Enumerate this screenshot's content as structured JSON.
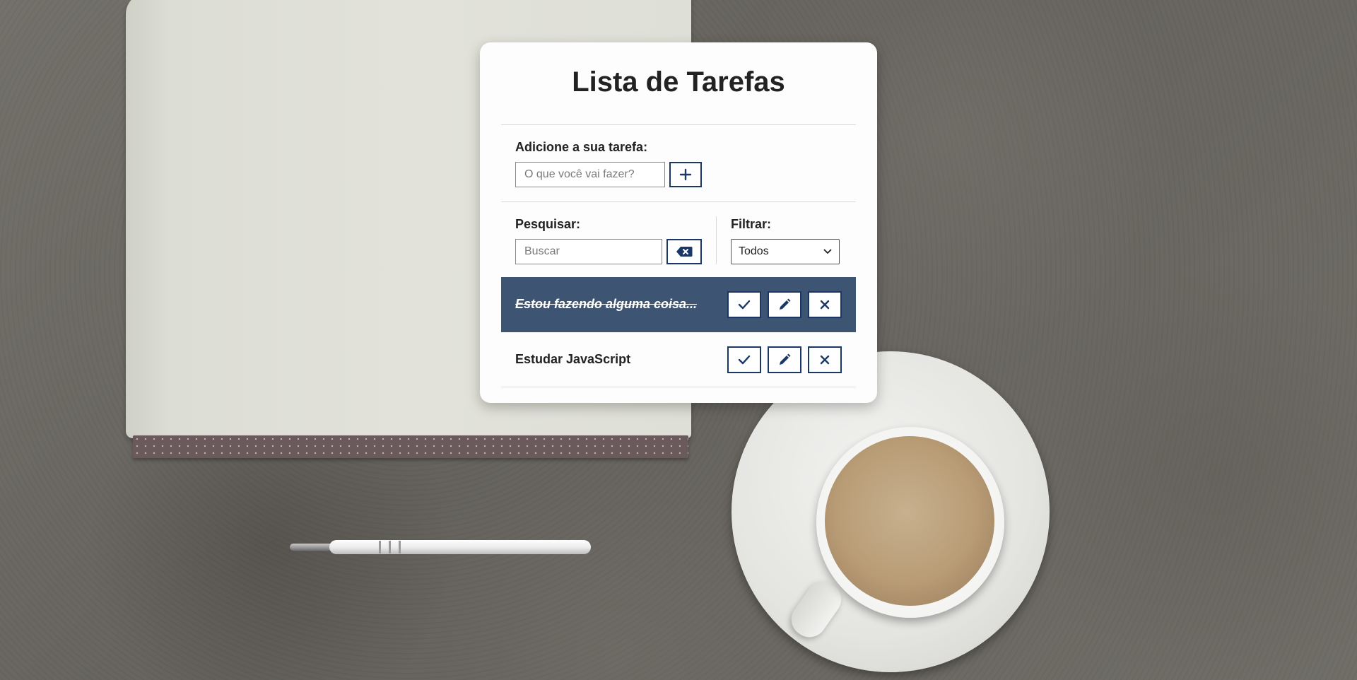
{
  "app": {
    "title": "Lista de Tarefas"
  },
  "add_section": {
    "label": "Adicione a sua tarefa:",
    "placeholder": "O que você vai fazer?",
    "value": "",
    "button_icon": "plus-icon"
  },
  "search_section": {
    "label": "Pesquisar:",
    "placeholder": "Buscar",
    "value": "",
    "clear_button_icon": "backspace-icon"
  },
  "filter_section": {
    "label": "Filtrar:",
    "selected": "Todos"
  },
  "todos": [
    {
      "text": "Estou fazendo alguma coisa...",
      "done": true
    },
    {
      "text": "Estudar JavaScript",
      "done": false
    }
  ],
  "colors": {
    "accent": "#1b3766",
    "done_row": "#3d5472",
    "card": "#fdfdfd"
  }
}
